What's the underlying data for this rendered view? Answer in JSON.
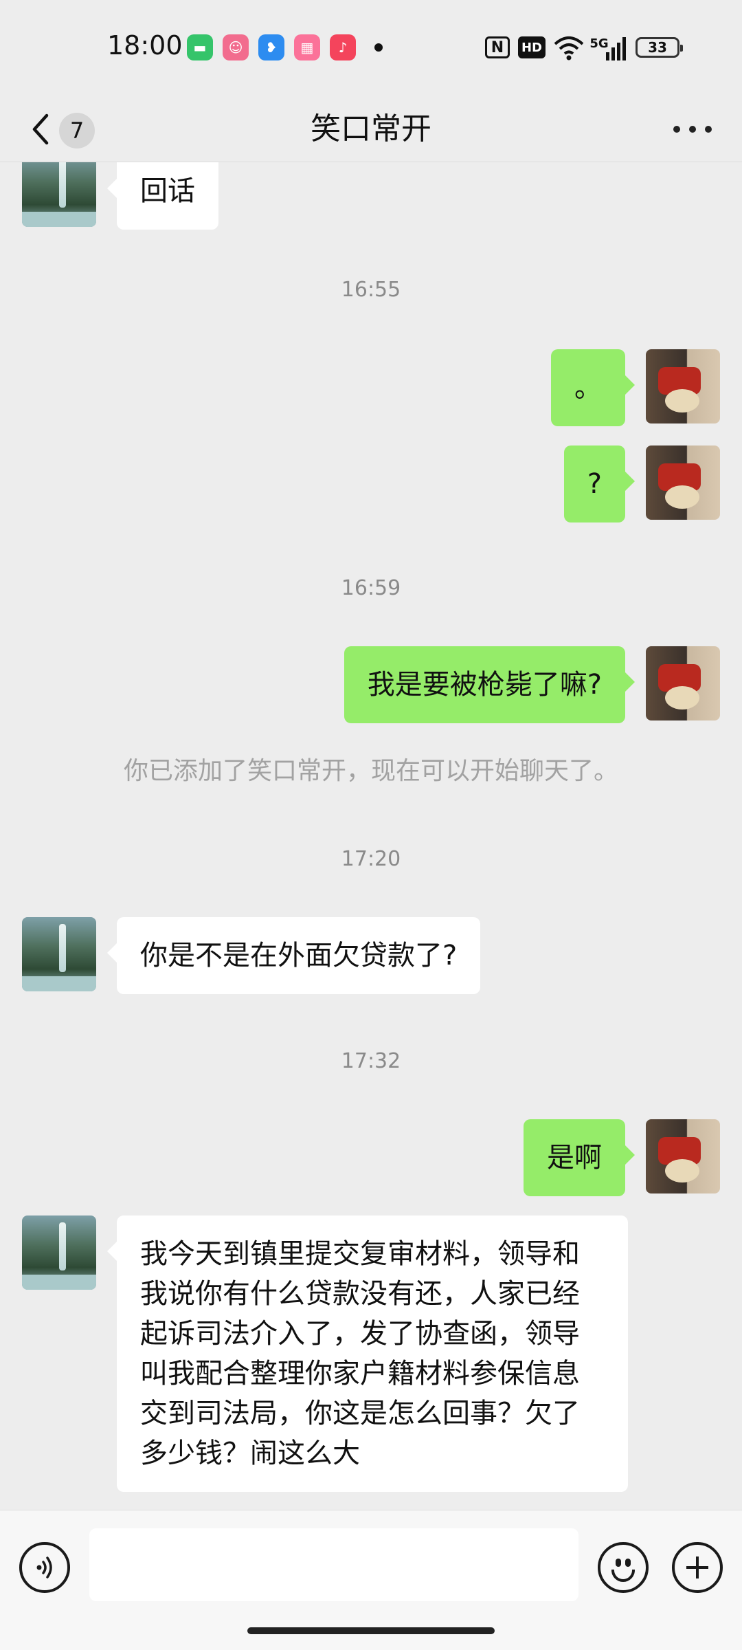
{
  "status_bar": {
    "time": "18:00",
    "apps": [
      {
        "name": "messages-app-icon",
        "color": "#35c46a",
        "glyph": "▬"
      },
      {
        "name": "cartoon-app-icon",
        "color": "#f26c8e",
        "glyph": "☺"
      },
      {
        "name": "feather-app-icon",
        "color": "#2d8cf0",
        "glyph": "❥"
      },
      {
        "name": "bilibili-app-icon",
        "color": "#fb7299",
        "glyph": "▦"
      },
      {
        "name": "music-app-icon",
        "color": "#f4445c",
        "glyph": "♪"
      }
    ],
    "nfc": "N",
    "hd": "HD",
    "network": "5G",
    "battery": "33"
  },
  "header": {
    "unread_count": "7",
    "title": "笑口常开"
  },
  "messages": [
    {
      "type": "text",
      "side": "left",
      "text": "回话",
      "avatar": "waterfall"
    },
    {
      "type": "time",
      "text": "16:55"
    },
    {
      "type": "text",
      "side": "right",
      "text": "。",
      "avatar": "bear"
    },
    {
      "type": "text",
      "side": "right",
      "text": "?",
      "avatar": "bear"
    },
    {
      "type": "time",
      "text": "16:59"
    },
    {
      "type": "text",
      "side": "right",
      "text": "我是要被枪毙了嘛?",
      "avatar": "bear"
    },
    {
      "type": "system",
      "text": "你已添加了笑口常开，现在可以开始聊天了。"
    },
    {
      "type": "time",
      "text": "17:20"
    },
    {
      "type": "text",
      "side": "left",
      "text": "你是不是在外面欠贷款了?",
      "avatar": "waterfall"
    },
    {
      "type": "time",
      "text": "17:32"
    },
    {
      "type": "text",
      "side": "right",
      "text": "是啊",
      "avatar": "bear"
    },
    {
      "type": "text",
      "side": "left",
      "text": "我今天到镇里提交复审材料，领导和我说你有什么贷款没有还，人家已经起诉司法介入了，发了协查函，领导叫我配合整理你家户籍材料参保信息交到司法局，你这是怎么回事？欠了多少钱？闹这么大",
      "avatar": "waterfall"
    }
  ],
  "input": {
    "value": "",
    "placeholder": ""
  },
  "colors": {
    "background": "#ededed",
    "sent_bubble": "#95ec69",
    "received_bubble": "#ffffff"
  }
}
